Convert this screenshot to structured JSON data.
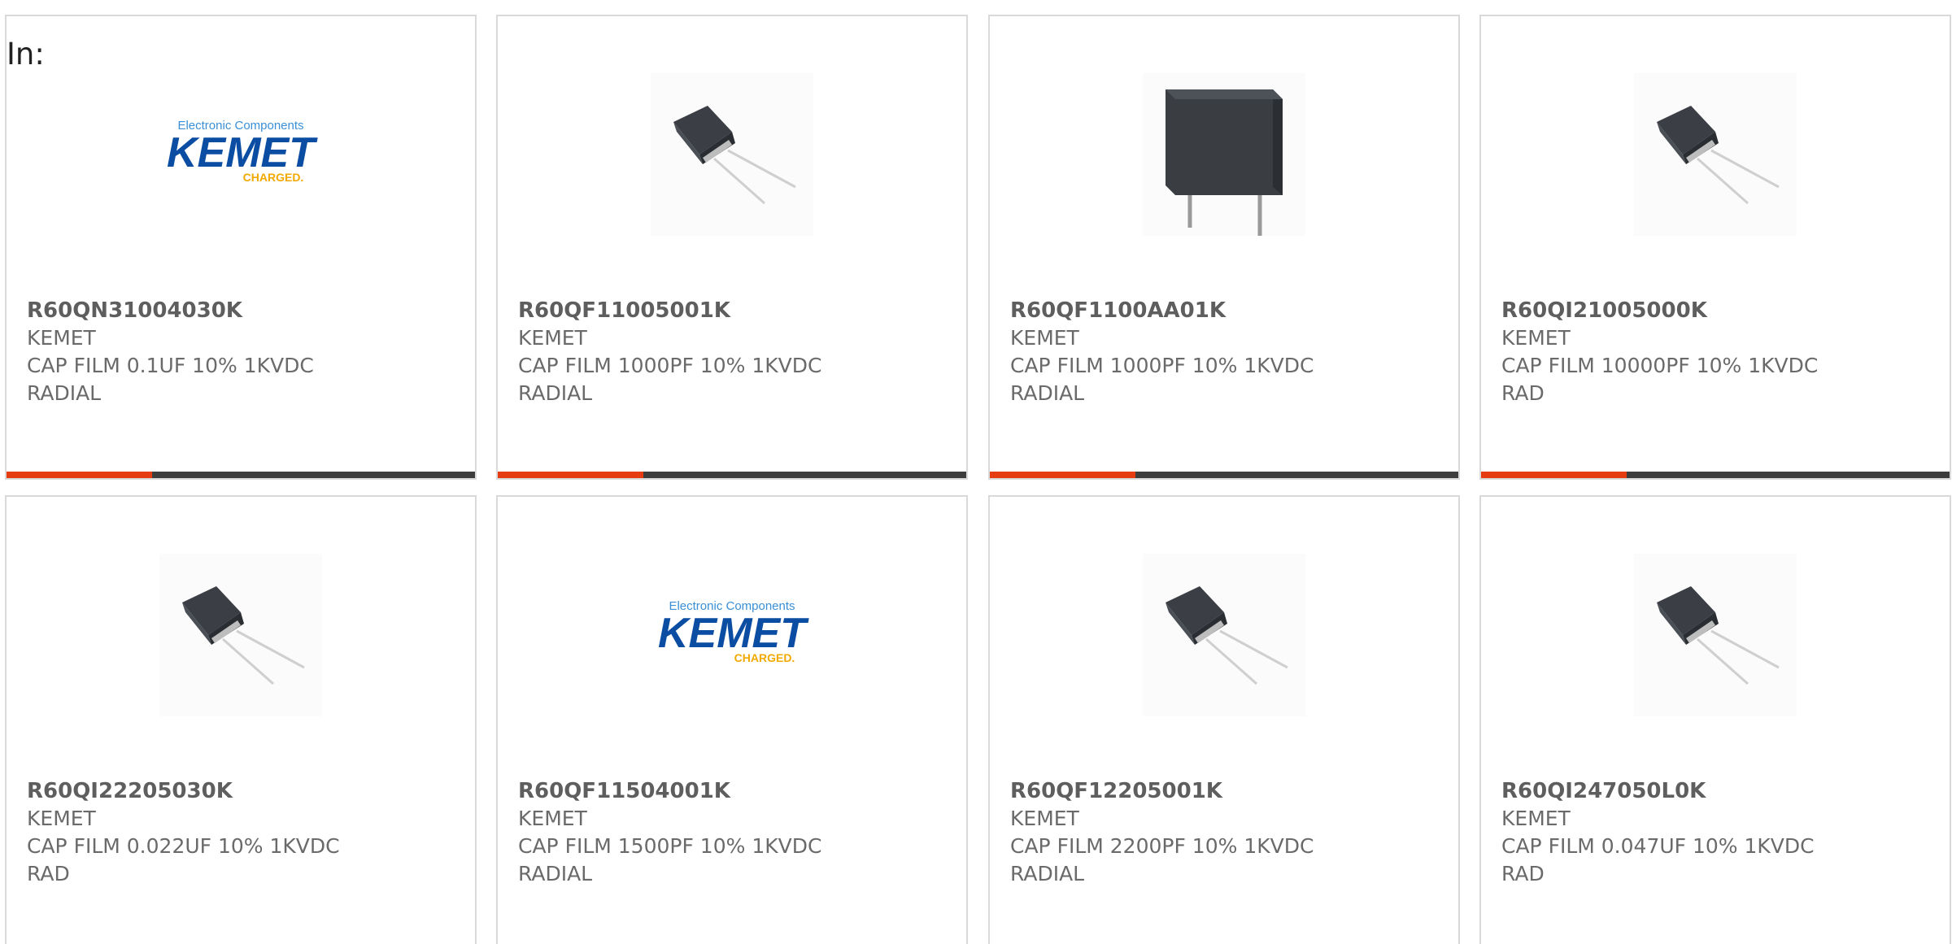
{
  "header": {
    "in_label": "In:"
  },
  "colors": {
    "accent": "#e63c12",
    "bar_track": "#3d3d3d",
    "kemet_blue": "#0a4da2",
    "kemet_yellow": "#f2a900"
  },
  "cards": [
    {
      "part_number": "R60QN31004030K",
      "manufacturer": "KEMET",
      "desc_line1": "CAP FILM 0.1UF 10% 1KVDC",
      "desc_line2": "RADIAL",
      "image": "kemet-logo",
      "progress": 0.31,
      "logo": {
        "tagline": "Electronic Components",
        "brand": "KEMET",
        "slogan": "CHARGED."
      }
    },
    {
      "part_number": "R60QF11005001K",
      "manufacturer": "KEMET",
      "desc_line1": "CAP FILM 1000PF 10% 1KVDC",
      "desc_line2": "RADIAL",
      "image": "film-capacitor-angled",
      "progress": 0.31
    },
    {
      "part_number": "R60QF1100AA01K",
      "manufacturer": "KEMET",
      "desc_line1": "CAP FILM 1000PF 10% 1KVDC",
      "desc_line2": "RADIAL",
      "image": "film-capacitor-front",
      "progress": 0.31
    },
    {
      "part_number": "R60QI21005000K",
      "manufacturer": "KEMET",
      "desc_line1": "CAP FILM 10000PF 10% 1KVDC",
      "desc_line2": "RAD",
      "image": "film-capacitor-angled",
      "progress": 0.31
    },
    {
      "part_number": "R60QI22205030K",
      "manufacturer": "KEMET",
      "desc_line1": "CAP FILM 0.022UF 10% 1KVDC",
      "desc_line2": "RAD",
      "image": "film-capacitor-angled"
    },
    {
      "part_number": "R60QF11504001K",
      "manufacturer": "KEMET",
      "desc_line1": "CAP FILM 1500PF 10% 1KVDC",
      "desc_line2": "RADIAL",
      "image": "kemet-logo",
      "logo": {
        "tagline": "Electronic Components",
        "brand": "KEMET",
        "slogan": "CHARGED."
      }
    },
    {
      "part_number": "R60QF12205001K",
      "manufacturer": "KEMET",
      "desc_line1": "CAP FILM 2200PF 10% 1KVDC",
      "desc_line2": "RADIAL",
      "image": "film-capacitor-angled"
    },
    {
      "part_number": "R60QI247050L0K",
      "manufacturer": "KEMET",
      "desc_line1": "CAP FILM 0.047UF 10% 1KVDC",
      "desc_line2": "RAD",
      "image": "film-capacitor-angled"
    }
  ]
}
